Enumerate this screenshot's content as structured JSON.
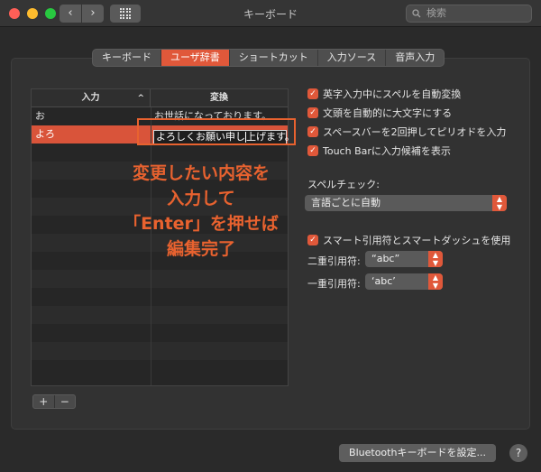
{
  "window": {
    "title": "キーボード",
    "search_placeholder": "検索",
    "nav_back": "‹",
    "nav_forward": "›"
  },
  "tabs": [
    {
      "label": "キーボード",
      "active": false
    },
    {
      "label": "ユーザ辞書",
      "active": true
    },
    {
      "label": "ショートカット",
      "active": false
    },
    {
      "label": "入力ソース",
      "active": false
    },
    {
      "label": "音声入力",
      "active": false
    }
  ],
  "table": {
    "col_input": "入力",
    "col_conversion": "変換",
    "sort_indicator": "^",
    "rows": [
      {
        "input": "お",
        "conversion": "お世話になっております。",
        "selected": false
      },
      {
        "input": "よろ",
        "conversion": "",
        "selected": true
      }
    ],
    "edit_value_before": "よろしくお願い申し",
    "edit_value_after": "上げます。",
    "add_label": "+",
    "remove_label": "−"
  },
  "annotation": {
    "lines": [
      "変更したい内容を",
      "入力して",
      "「Enter」を押せば",
      "編集完了"
    ]
  },
  "options": {
    "checkboxes": [
      {
        "label": "英字入力中にスペルを自動変換",
        "checked": true
      },
      {
        "label": "文頭を自動的に大文字にする",
        "checked": true
      },
      {
        "label": "スペースバーを2回押してピリオドを入力",
        "checked": true
      },
      {
        "label": "Touch Barに入力候補を表示",
        "checked": true
      }
    ],
    "spellcheck_label": "スペルチェック:",
    "spellcheck_value": "言語ごとに自動",
    "smart_quotes": {
      "label": "スマート引用符とスマートダッシュを使用",
      "checked": true
    },
    "double_quote_label": "二重引用符:",
    "double_quote_value": "“abc”",
    "single_quote_label": "一重引用符:",
    "single_quote_value": "‘abc’"
  },
  "footer": {
    "bluetooth_button": "Bluetoothキーボードを設定...",
    "help_label": "?"
  },
  "colors": {
    "accent": "#e0583a",
    "annotation": "#e8622f"
  }
}
